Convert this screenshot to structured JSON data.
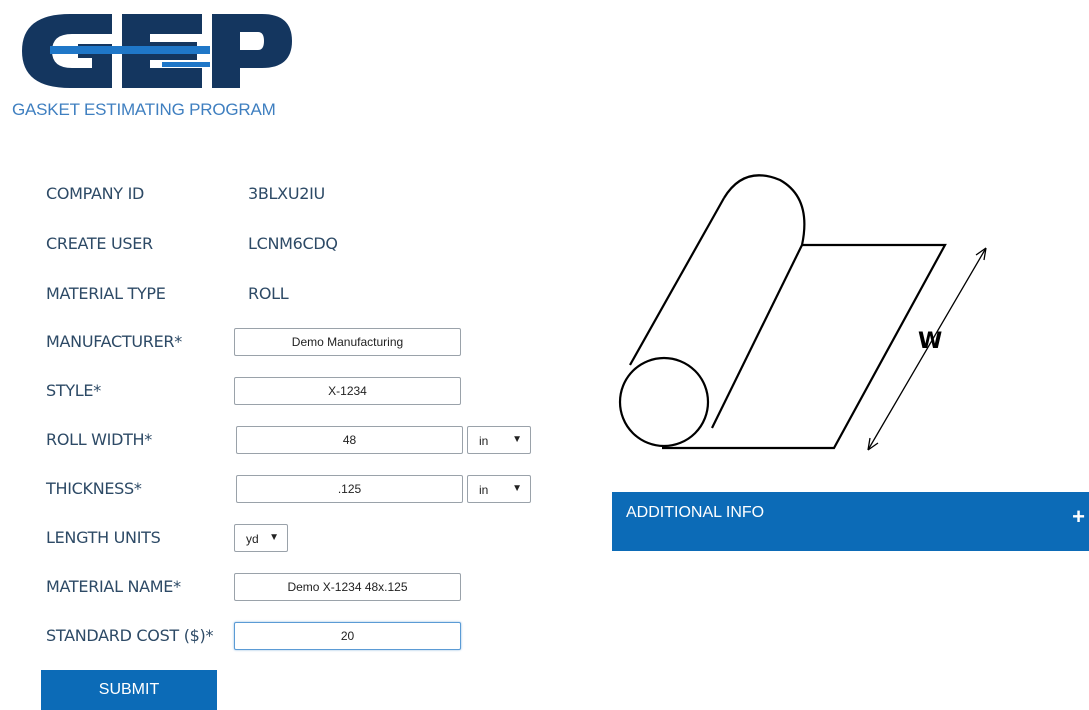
{
  "logo": {
    "letters": "GEP",
    "subtitle": "GASKET ESTIMATING PROGRAM",
    "color": "#14365f",
    "accent": "#1f77c8"
  },
  "form": {
    "company_id_label": "COMPANY ID",
    "company_id_value": "3BLXU2IU",
    "create_user_label": "CREATE USER",
    "create_user_value": "LCNM6CDQ",
    "material_type_label": "MATERIAL TYPE",
    "material_type_value": "ROLL",
    "manufacturer_label": "MANUFACTURER*",
    "manufacturer_value": "Demo Manufacturing",
    "style_label": "STYLE*",
    "style_value": "X-1234",
    "roll_width_label": "ROLL WIDTH*",
    "roll_width_value": "48",
    "roll_width_unit": "in",
    "thickness_label": "THICKNESS*",
    "thickness_value": ".125",
    "thickness_unit": "in",
    "length_units_label": "LENGTH UNITS",
    "length_units_value": "yd",
    "material_name_label": "MATERIAL NAME*",
    "material_name_value": "Demo X-1234 48x.125",
    "standard_cost_label": "STANDARD COST ($)*",
    "standard_cost_value": "20",
    "submit_label": "SUBMIT"
  },
  "diagram": {
    "width_label": "W"
  },
  "additional_info": {
    "label": "ADDITIONAL INFO",
    "toggle": "+"
  },
  "colors": {
    "primary_button": "#0c6bb7",
    "label_text": "#2d4a66"
  }
}
